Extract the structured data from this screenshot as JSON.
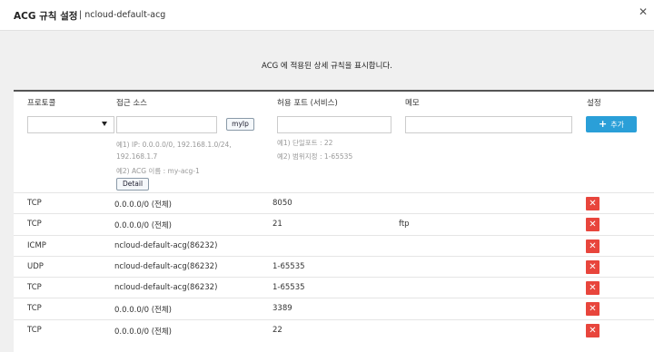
{
  "header": {
    "title": "ACG 규칙 설정",
    "subtitle": "| ncloud-default-acg",
    "close_glyph": "✕"
  },
  "description": "ACG 에 적용된 상세 규칙을 표시합니다.",
  "columns": {
    "protocol": "프로토콜",
    "source": "접근 소스",
    "port": "허용 포트 (서비스)",
    "memo": "메모",
    "settings": "설정"
  },
  "form": {
    "protocol_value": "",
    "source_value": "",
    "port_value": "",
    "memo_value": "",
    "myip_label": "myIp",
    "source_hint_1": "예1) IP: 0.0.0.0/0, 192.168.1.0/24,",
    "source_hint_2": "192.168.1.7",
    "source_hint_3": "예2) ACG 이름 : my-acg-1",
    "detail_label": "Detail",
    "port_hint_1": "예1) 단일포트 : 22",
    "port_hint_2": "예2) 범위지정 : 1-65535",
    "add_icon": "+",
    "add_label": "추가"
  },
  "rules": [
    {
      "protocol": "TCP",
      "source": "0.0.0.0/0 (전체)",
      "port": "8050",
      "memo": "",
      "delete_glyph": "✕"
    },
    {
      "protocol": "TCP",
      "source": "0.0.0.0/0 (전체)",
      "port": "21",
      "memo": "ftp",
      "delete_glyph": "✕"
    },
    {
      "protocol": "ICMP",
      "source": "ncloud-default-acg(86232)",
      "port": "",
      "memo": "",
      "delete_glyph": "✕"
    },
    {
      "protocol": "UDP",
      "source": "ncloud-default-acg(86232)",
      "port": "1-65535",
      "memo": "",
      "delete_glyph": "✕"
    },
    {
      "protocol": "TCP",
      "source": "ncloud-default-acg(86232)",
      "port": "1-65535",
      "memo": "",
      "delete_glyph": "✕"
    },
    {
      "protocol": "TCP",
      "source": "0.0.0.0/0 (전체)",
      "port": "3389",
      "memo": "",
      "delete_glyph": "✕"
    },
    {
      "protocol": "TCP",
      "source": "0.0.0.0/0 (전체)",
      "port": "22",
      "memo": "",
      "delete_glyph": "✕"
    }
  ],
  "colors": {
    "add_button": "#2a9fd8",
    "delete_button": "#e8453c",
    "background": "#f0f0f0"
  }
}
